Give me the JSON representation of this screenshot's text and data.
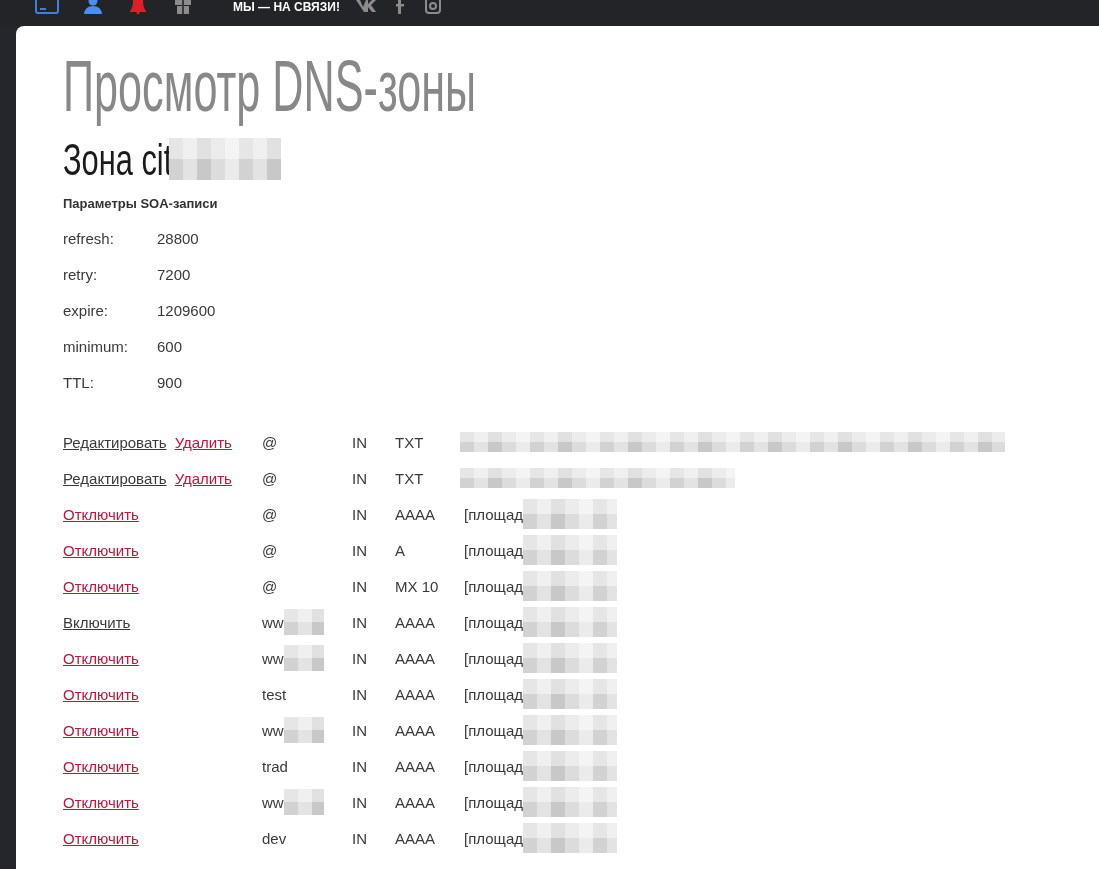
{
  "top_bar": {
    "slogan": "МЫ — НА СВЯЗИ!"
  },
  "page": {
    "title": "Просмотр DNS-зоны",
    "zone": {
      "label": "Зона cit",
      "redacted": true
    }
  },
  "soa": {
    "heading": "Параметры SOA-записи",
    "params": [
      {
        "label": "refresh:",
        "value": "28800"
      },
      {
        "label": "retry:",
        "value": "7200"
      },
      {
        "label": "expire:",
        "value": "1209600"
      },
      {
        "label": "minimum:",
        "value": "600"
      },
      {
        "label": "TTL:",
        "value": "900"
      }
    ]
  },
  "records": [
    {
      "actions": [
        {
          "kind": "edit",
          "label": "Редактировать"
        },
        {
          "kind": "delete",
          "label": "Удалить"
        }
      ],
      "name": "@",
      "name_redacted": false,
      "class": "IN",
      "type": "TXT",
      "data_redacted": true
    },
    {
      "actions": [
        {
          "kind": "edit",
          "label": "Редактировать"
        },
        {
          "kind": "delete",
          "label": "Удалить"
        }
      ],
      "name": "@",
      "name_redacted": false,
      "class": "IN",
      "type": "TXT",
      "data_redacted": true
    },
    {
      "actions": [
        {
          "kind": "disable",
          "label": "Отключить"
        }
      ],
      "name": "@",
      "name_redacted": false,
      "class": "IN",
      "type": "AAAA",
      "data": "[площад",
      "data_redacted": true
    },
    {
      "actions": [
        {
          "kind": "disable",
          "label": "Отключить"
        }
      ],
      "name": "@",
      "name_redacted": false,
      "class": "IN",
      "type": "A",
      "data": "[площад",
      "data_redacted": true
    },
    {
      "actions": [
        {
          "kind": "disable",
          "label": "Отключить"
        }
      ],
      "name": "@",
      "name_redacted": false,
      "class": "IN",
      "type": "MX 10",
      "data": "[площад",
      "data_redacted": true
    },
    {
      "actions": [
        {
          "kind": "enable",
          "label": "Включить"
        }
      ],
      "name": "ww",
      "name_redacted": true,
      "class": "IN",
      "type": "AAAA",
      "data": "[площад",
      "data_redacted": true
    },
    {
      "actions": [
        {
          "kind": "disable",
          "label": "Отключить"
        }
      ],
      "name": "ww",
      "name_redacted": true,
      "class": "IN",
      "type": "AAAA",
      "data": "[площад",
      "data_redacted": true
    },
    {
      "actions": [
        {
          "kind": "disable",
          "label": "Отключить"
        }
      ],
      "name": "test",
      "name_redacted": false,
      "class": "IN",
      "type": "AAAA",
      "data": "[площад",
      "data_redacted": true
    },
    {
      "actions": [
        {
          "kind": "disable",
          "label": "Отключить"
        }
      ],
      "name": "ww",
      "name_redacted": true,
      "class": "IN",
      "type": "AAAA",
      "data": "[площад",
      "data_redacted": true
    },
    {
      "actions": [
        {
          "kind": "disable",
          "label": "Отключить"
        }
      ],
      "name": "trad",
      "name_redacted": false,
      "class": "IN",
      "type": "AAAA",
      "data": "[площад",
      "data_redacted": true
    },
    {
      "actions": [
        {
          "kind": "disable",
          "label": "Отключить"
        }
      ],
      "name": "ww",
      "name_redacted": true,
      "class": "IN",
      "type": "AAAA",
      "data": "[площад",
      "data_redacted": true
    },
    {
      "actions": [
        {
          "kind": "disable",
          "label": "Отключить"
        }
      ],
      "name": "dev",
      "name_redacted": false,
      "class": "IN",
      "type": "AAAA",
      "data": "[площад",
      "data_redacted": true
    }
  ]
}
